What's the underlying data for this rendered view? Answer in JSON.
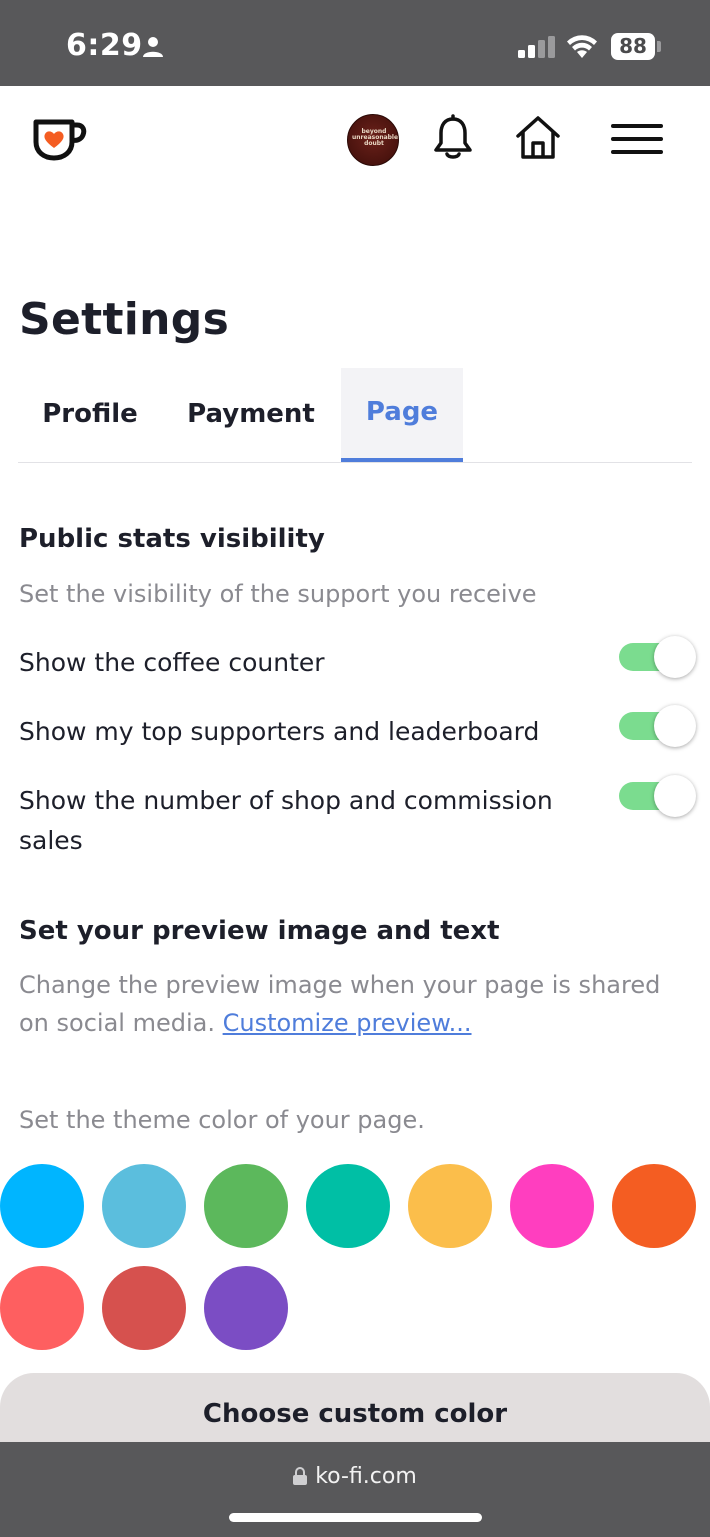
{
  "status_bar": {
    "time": "6:29",
    "battery": "88"
  },
  "header": {
    "avatar_text": "beyond unreasonable doubt"
  },
  "settings": {
    "title": "Settings",
    "tabs": [
      {
        "label": "Profile",
        "active": false
      },
      {
        "label": "Payment",
        "active": false
      },
      {
        "label": "Page",
        "active": true
      }
    ]
  },
  "stats_visibility": {
    "title": "Public stats visibility",
    "description": "Set the visibility of the support you receive",
    "toggles": [
      {
        "label": "Show the coffee counter",
        "on": true
      },
      {
        "label": "Show my top supporters and leaderboard",
        "on": true
      },
      {
        "label": "Show the number of shop and commission sales",
        "on": true
      }
    ]
  },
  "preview": {
    "title": "Set your preview image and text",
    "description": "Change the preview image when your page is shared on social media.",
    "link_text": "Customize preview..."
  },
  "theme": {
    "description": "Set the theme color of your page.",
    "colors": [
      "#00b5ff",
      "#5bbedd",
      "#5cb85c",
      "#00bfa5",
      "#fbbe4b",
      "#ff3ebf",
      "#f45d22",
      "#fe5f60",
      "#d6514e",
      "#7b4dc4"
    ],
    "custom_button": "Choose custom color"
  },
  "browser": {
    "url": "ko-fi.com"
  },
  "accent_color": "#4f7ddb",
  "toggle_color": "#7bdc8f"
}
